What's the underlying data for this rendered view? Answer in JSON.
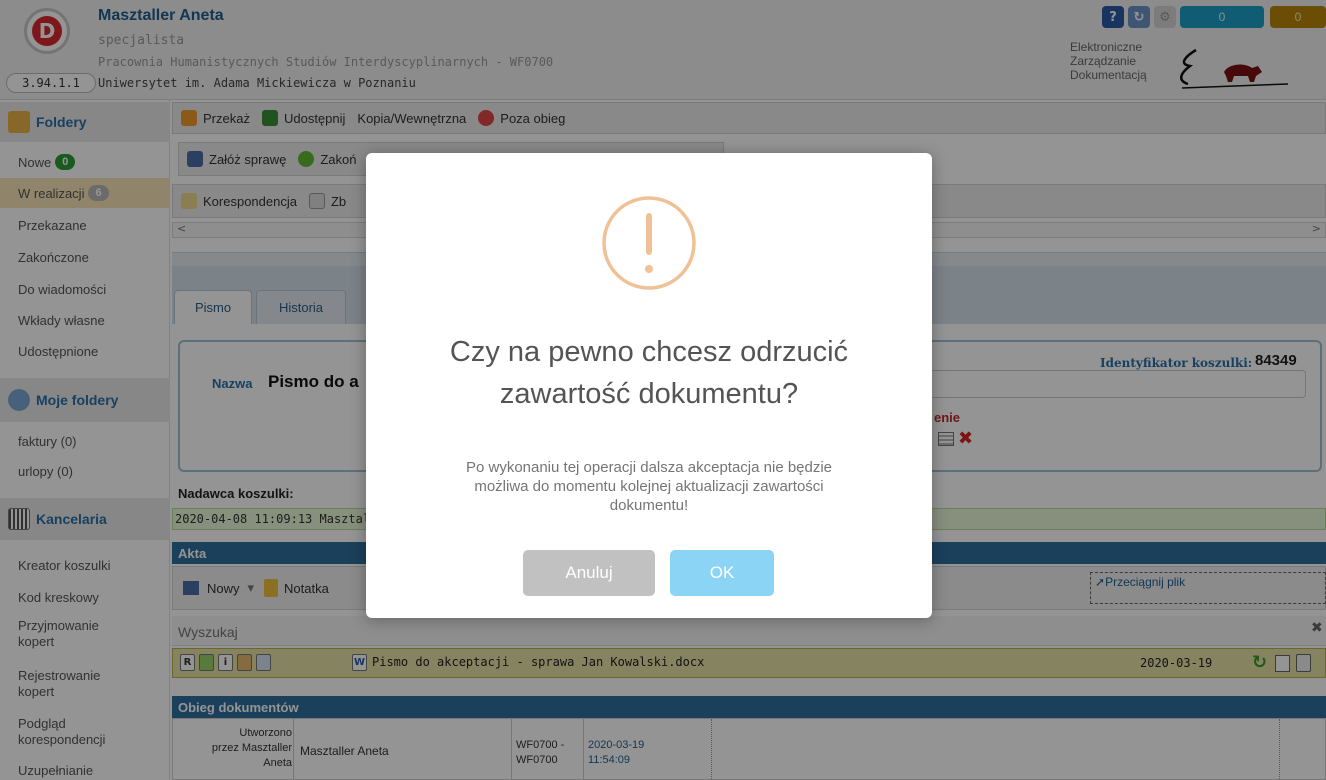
{
  "header": {
    "user_name": "Masztaller Aneta",
    "role": "specjalista",
    "unit": "Pracownia Humanistycznych Studiów Interdyscyplinarnych - WF0700",
    "university": "Uniwersytet im. Adama Mickiewicza w Poznaniu",
    "version": "3.94.1.1",
    "system_name": [
      "Elektroniczne",
      "Zarządzanie",
      "Dokumentacją"
    ],
    "counter_1": "0",
    "counter_2": "0",
    "logo_letter": "D"
  },
  "sidebar": {
    "foldery_title": "Foldery",
    "items": [
      {
        "label": "Nowe",
        "badge": "0"
      },
      {
        "label": "W realizacji",
        "badge": "6"
      },
      {
        "label": "Przekazane"
      },
      {
        "label": "Zakończone"
      },
      {
        "label": "Do wiadomości"
      },
      {
        "label": "Wkłady własne"
      },
      {
        "label": "Udostępnione"
      }
    ],
    "moje_foldery_title": "Moje foldery",
    "moje_items": [
      "faktury (0)",
      "urlopy (0)"
    ],
    "kancelaria_title": "Kancelaria",
    "kancelaria_items": [
      [
        "Kreator koszulki"
      ],
      [
        "Kod kreskowy"
      ],
      [
        "Przyjmowanie",
        "kopert"
      ],
      [
        "Rejestrowanie",
        "kopert"
      ],
      [
        "Podgląd",
        "korespondencji"
      ],
      [
        "Uzupełnianie"
      ]
    ]
  },
  "toolbar1": {
    "przekaz": "Przekaż",
    "udostepnij": "Udostępnij",
    "kopia": "Kopia/Wewnętrzna",
    "poza_obieg": "Poza obieg"
  },
  "toolbar2": {
    "zaloz": "Załóż sprawę",
    "zakon": "Zakoń"
  },
  "toolbar3": {
    "korespondencja": "Korespondencja",
    "zb": "Zb"
  },
  "scroll": {
    "left": "<",
    "right": ">"
  },
  "tabs": {
    "pismo": "Pismo",
    "historia": "Historia"
  },
  "document": {
    "nazwa_label": "Nazwa",
    "nazwa_value": "Pismo do a",
    "ident_label": "Identyfikator koszulki:",
    "ident_value": "84349",
    "red_fragment": "enie"
  },
  "sender": {
    "label": "Nadawca koszulki:",
    "value": "2020-04-08 11:09:13  Masztal"
  },
  "akta": {
    "title": "Akta",
    "nowy": "Nowy",
    "dropdown_arrow": "▾",
    "notatka": "Notatka",
    "drop": "Przeciągnij plik",
    "search_placeholder": "Wyszukaj",
    "search_clear": "✖"
  },
  "file": {
    "icon_letters": [
      "R",
      "",
      "i",
      "",
      ""
    ],
    "type_letter": "W",
    "name": "Pismo do akceptacji - sprawa Jan Kowalski.docx",
    "date": "2020-03-19"
  },
  "obieg": {
    "title": "Obieg dokumentów",
    "created_by": [
      "Utworzono",
      "przez Masztaller",
      "Aneta"
    ],
    "person": "Masztaller Aneta",
    "unit": [
      "WF0700 -",
      "WF0700"
    ],
    "datetime": [
      "2020-03-19",
      "11:54:09"
    ]
  },
  "modal": {
    "title_line1": "Czy na pewno chcesz odrzucić",
    "title_line2": "zawartość dokumentu?",
    "text_line1": "Po wykonaniu tej operacji dalsza akceptacja nie będzie",
    "text_line2": "możliwa do momentu kolejnej aktualizacji zawartości",
    "text_line3": "dokumentu!",
    "cancel": "Anuluj",
    "ok": "OK"
  },
  "colors": {
    "accent_blue": "#2a6fa8",
    "warning_orange": "#f0c196",
    "cancel_gray": "#c1c1c1",
    "ok_blue": "#8cd4f5"
  }
}
